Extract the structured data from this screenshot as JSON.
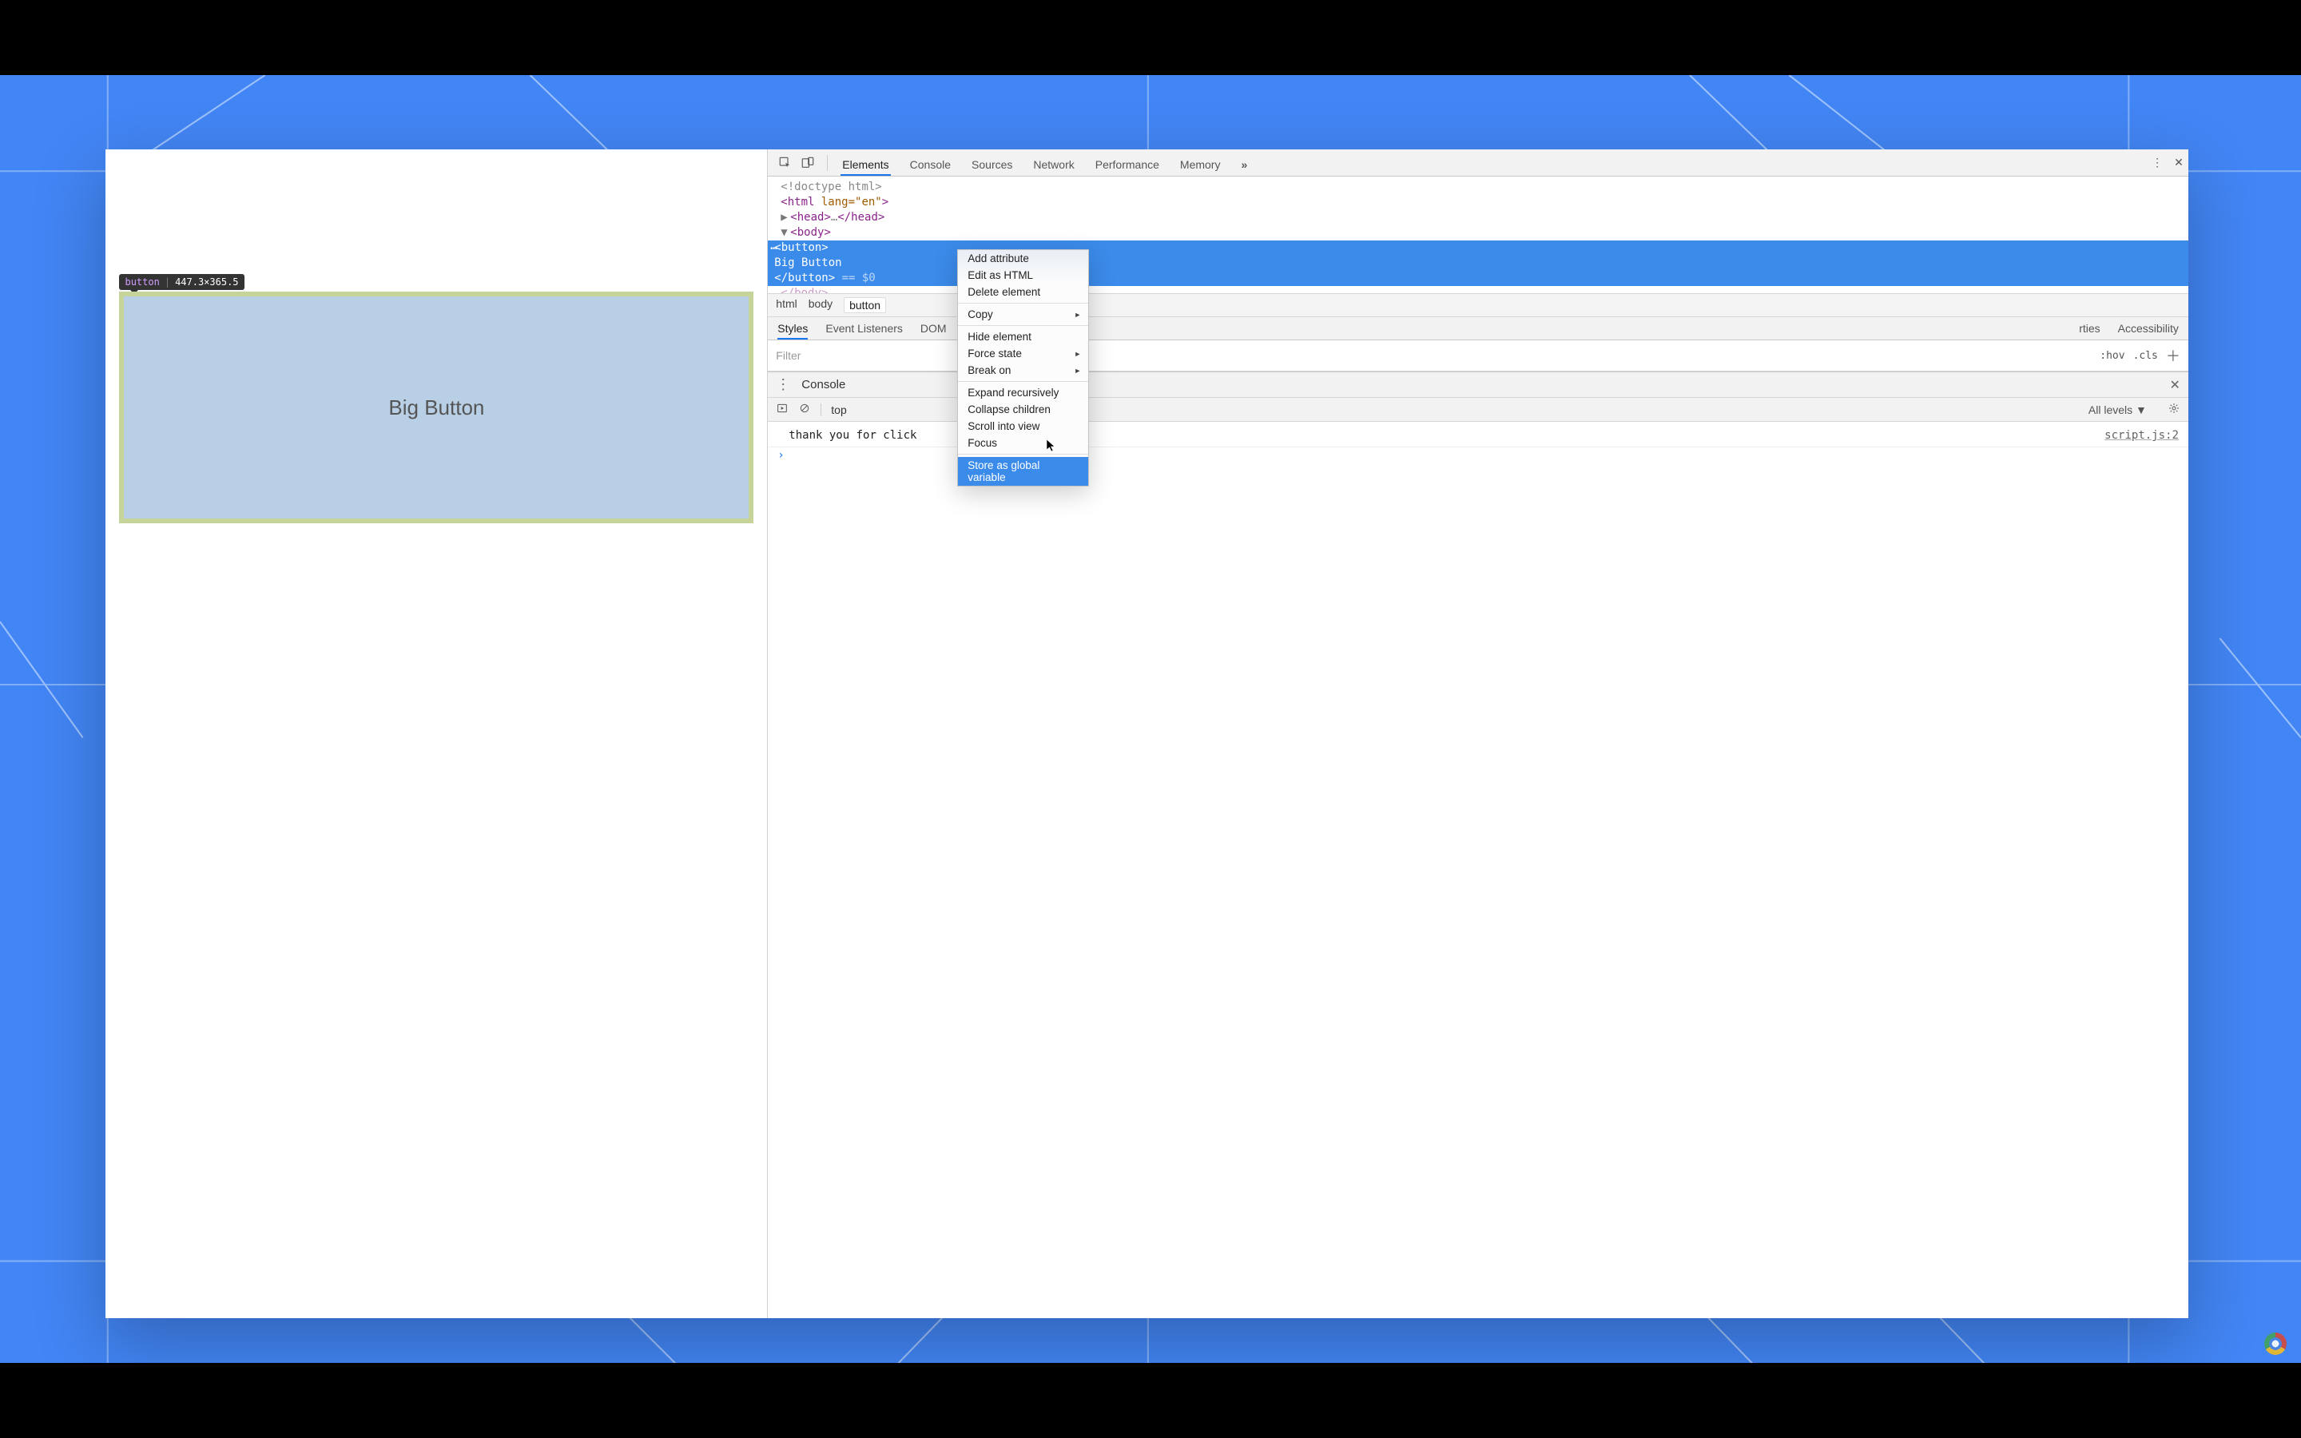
{
  "tooltip": {
    "element": "button",
    "dims": "447.3×365.5"
  },
  "page": {
    "button_label": "Big Button"
  },
  "toolbar": {
    "tabs": [
      "Elements",
      "Console",
      "Sources",
      "Network",
      "Performance",
      "Memory"
    ],
    "overflow_glyph": "»",
    "kebab_glyph": "⋮",
    "close_glyph": "✕",
    "active_tab": "Elements"
  },
  "dom": {
    "l1": "<!doctype html>",
    "l2a": "<html ",
    "l2attr": "lang=\"en\"",
    "l2b": ">",
    "l3a": "<head>",
    "l3dots": "…",
    "l3b": "</head>",
    "l4": "<body>",
    "sel_open": "<button>",
    "sel_text": "Big Button",
    "sel_close": "</button>",
    "sel_eq": " == $0",
    "l6": "</body>"
  },
  "crumbs": [
    "html",
    "body",
    "button"
  ],
  "subtabs": {
    "items": [
      "Styles",
      "Event Listeners",
      "DOM Breakpoints",
      "Properties",
      "Accessibility"
    ],
    "active": "Styles",
    "dom_trunc": "DOM",
    "props_trunc": "rties"
  },
  "filter": {
    "placeholder": "Filter",
    "hov": ":hov",
    "cls": ".cls"
  },
  "drawer": {
    "title": "Console",
    "context": "top",
    "levels": "All levels ▼",
    "log": "thank you for click",
    "source": "script.js:2",
    "prompt_glyph": "›"
  },
  "ctx": {
    "items": [
      {
        "label": "Add attribute"
      },
      {
        "label": "Edit as HTML"
      },
      {
        "label": "Delete element"
      },
      {
        "divider": true
      },
      {
        "label": "Copy",
        "sub": true
      },
      {
        "divider": true
      },
      {
        "label": "Hide element"
      },
      {
        "label": "Force state",
        "sub": true
      },
      {
        "label": "Break on",
        "sub": true
      },
      {
        "divider": true
      },
      {
        "label": "Expand recursively"
      },
      {
        "label": "Collapse children"
      },
      {
        "label": "Scroll into view"
      },
      {
        "label": "Focus"
      },
      {
        "divider": true
      },
      {
        "label": "Store as global variable",
        "hover": true
      }
    ]
  }
}
